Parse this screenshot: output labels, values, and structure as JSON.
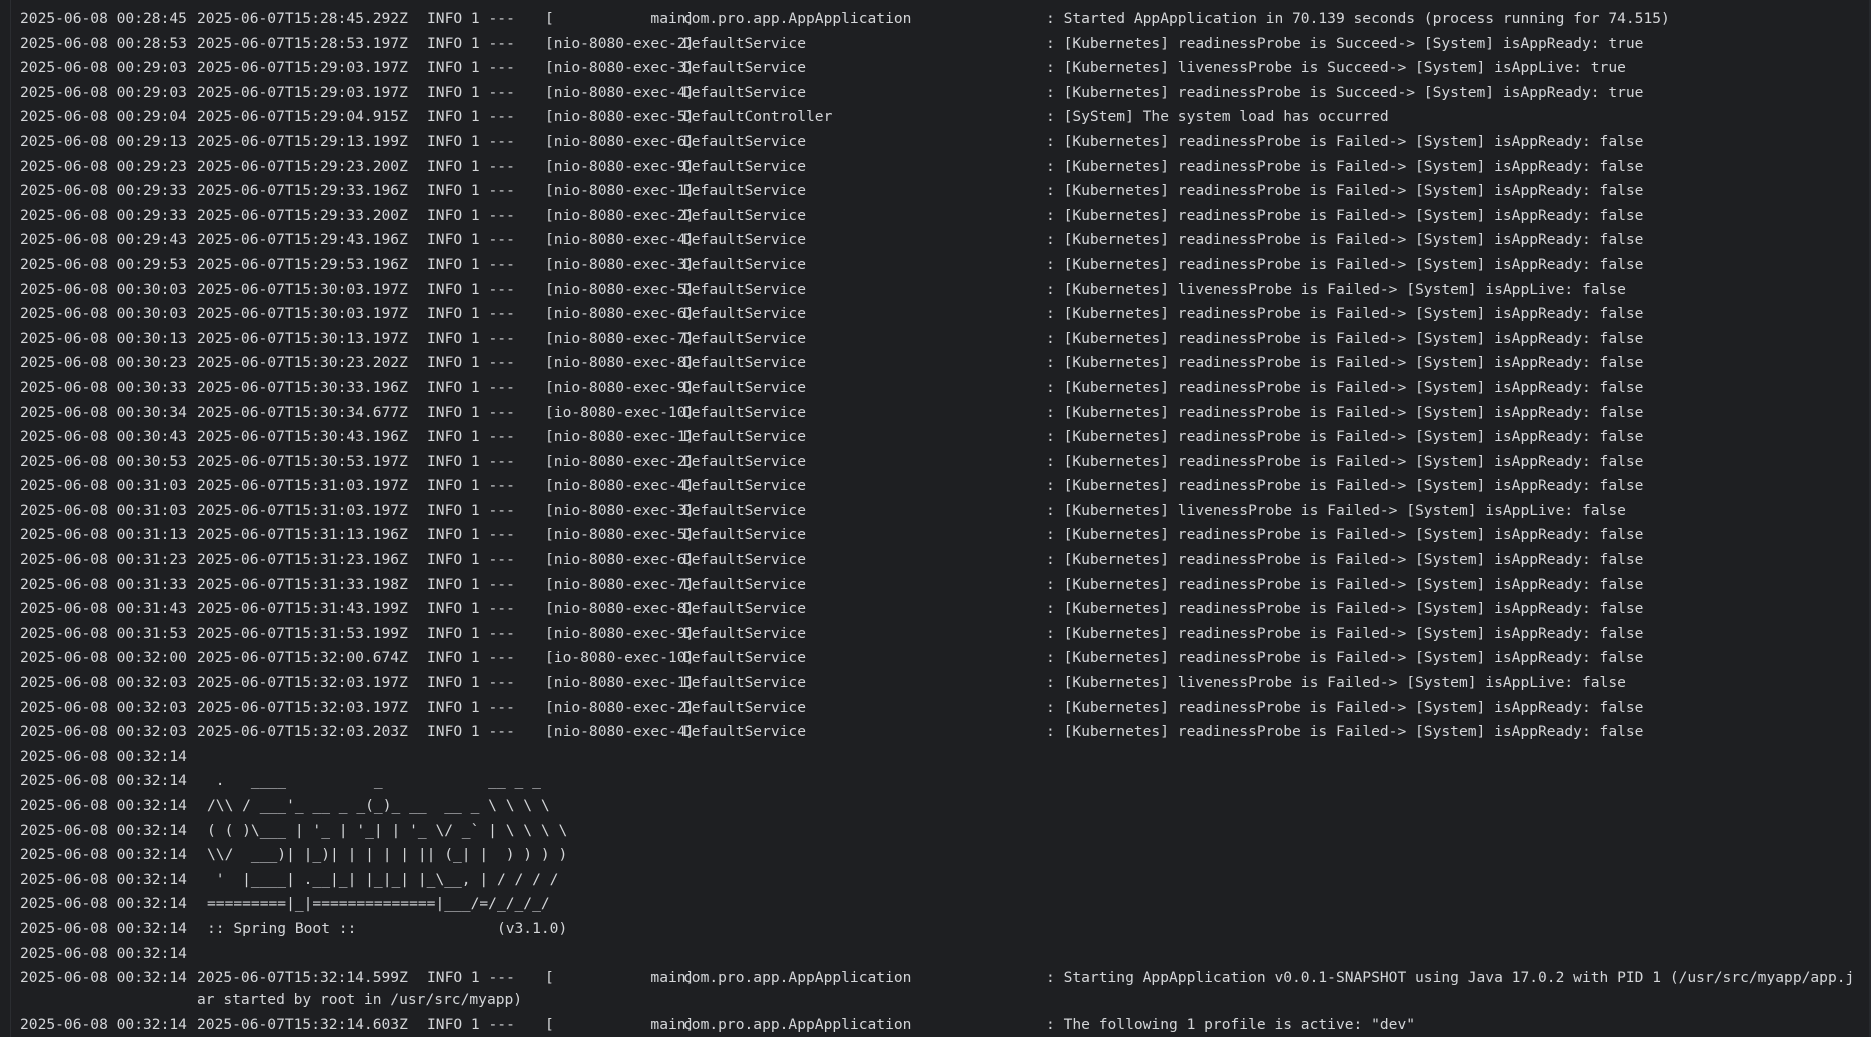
{
  "window": {
    "title": ""
  },
  "log_lines": [
    {
      "ts": "2025-06-08 00:28:45",
      "iso": "2025-06-07T15:28:45.292Z",
      "level": "INFO 1 ---",
      "thread": "[           main]",
      "logger": "com.pro.app.AppApplication",
      "msg": ": Started AppApplication in 70.139 seconds (process running for 74.515)"
    },
    {
      "ts": "2025-06-08 00:28:53",
      "iso": "2025-06-07T15:28:53.197Z",
      "level": "INFO 1 ---",
      "thread": "[nio-8080-exec-2]",
      "logger": "DefaultService",
      "msg": ": [Kubernetes] readinessProbe is Succeed-> [System] isAppReady: true"
    },
    {
      "ts": "2025-06-08 00:29:03",
      "iso": "2025-06-07T15:29:03.197Z",
      "level": "INFO 1 ---",
      "thread": "[nio-8080-exec-3]",
      "logger": "DefaultService",
      "msg": ": [Kubernetes] livenessProbe is Succeed-> [System] isAppLive: true"
    },
    {
      "ts": "2025-06-08 00:29:03",
      "iso": "2025-06-07T15:29:03.197Z",
      "level": "INFO 1 ---",
      "thread": "[nio-8080-exec-4]",
      "logger": "DefaultService",
      "msg": ": [Kubernetes] readinessProbe is Succeed-> [System] isAppReady: true"
    },
    {
      "ts": "2025-06-08 00:29:04",
      "iso": "2025-06-07T15:29:04.915Z",
      "level": "INFO 1 ---",
      "thread": "[nio-8080-exec-5]",
      "logger": "DefaultController",
      "msg": ": [SyStem] The system load has occurred"
    },
    {
      "ts": "2025-06-08 00:29:13",
      "iso": "2025-06-07T15:29:13.199Z",
      "level": "INFO 1 ---",
      "thread": "[nio-8080-exec-6]",
      "logger": "DefaultService",
      "msg": ": [Kubernetes] readinessProbe is Failed-> [System] isAppReady: false"
    },
    {
      "ts": "2025-06-08 00:29:23",
      "iso": "2025-06-07T15:29:23.200Z",
      "level": "INFO 1 ---",
      "thread": "[nio-8080-exec-9]",
      "logger": "DefaultService",
      "msg": ": [Kubernetes] readinessProbe is Failed-> [System] isAppReady: false"
    },
    {
      "ts": "2025-06-08 00:29:33",
      "iso": "2025-06-07T15:29:33.196Z",
      "level": "INFO 1 ---",
      "thread": "[nio-8080-exec-1]",
      "logger": "DefaultService",
      "msg": ": [Kubernetes] readinessProbe is Failed-> [System] isAppReady: false"
    },
    {
      "ts": "2025-06-08 00:29:33",
      "iso": "2025-06-07T15:29:33.200Z",
      "level": "INFO 1 ---",
      "thread": "[nio-8080-exec-2]",
      "logger": "DefaultService",
      "msg": ": [Kubernetes] readinessProbe is Failed-> [System] isAppReady: false"
    },
    {
      "ts": "2025-06-08 00:29:43",
      "iso": "2025-06-07T15:29:43.196Z",
      "level": "INFO 1 ---",
      "thread": "[nio-8080-exec-4]",
      "logger": "DefaultService",
      "msg": ": [Kubernetes] readinessProbe is Failed-> [System] isAppReady: false"
    },
    {
      "ts": "2025-06-08 00:29:53",
      "iso": "2025-06-07T15:29:53.196Z",
      "level": "INFO 1 ---",
      "thread": "[nio-8080-exec-3]",
      "logger": "DefaultService",
      "msg": ": [Kubernetes] readinessProbe is Failed-> [System] isAppReady: false"
    },
    {
      "ts": "2025-06-08 00:30:03",
      "iso": "2025-06-07T15:30:03.197Z",
      "level": "INFO 1 ---",
      "thread": "[nio-8080-exec-5]",
      "logger": "DefaultService",
      "msg": ": [Kubernetes] livenessProbe is Failed-> [System] isAppLive: false"
    },
    {
      "ts": "2025-06-08 00:30:03",
      "iso": "2025-06-07T15:30:03.197Z",
      "level": "INFO 1 ---",
      "thread": "[nio-8080-exec-6]",
      "logger": "DefaultService",
      "msg": ": [Kubernetes] readinessProbe is Failed-> [System] isAppReady: false"
    },
    {
      "ts": "2025-06-08 00:30:13",
      "iso": "2025-06-07T15:30:13.197Z",
      "level": "INFO 1 ---",
      "thread": "[nio-8080-exec-7]",
      "logger": "DefaultService",
      "msg": ": [Kubernetes] readinessProbe is Failed-> [System] isAppReady: false"
    },
    {
      "ts": "2025-06-08 00:30:23",
      "iso": "2025-06-07T15:30:23.202Z",
      "level": "INFO 1 ---",
      "thread": "[nio-8080-exec-8]",
      "logger": "DefaultService",
      "msg": ": [Kubernetes] readinessProbe is Failed-> [System] isAppReady: false"
    },
    {
      "ts": "2025-06-08 00:30:33",
      "iso": "2025-06-07T15:30:33.196Z",
      "level": "INFO 1 ---",
      "thread": "[nio-8080-exec-9]",
      "logger": "DefaultService",
      "msg": ": [Kubernetes] readinessProbe is Failed-> [System] isAppReady: false"
    },
    {
      "ts": "2025-06-08 00:30:34",
      "iso": "2025-06-07T15:30:34.677Z",
      "level": "INFO 1 ---",
      "thread": "[io-8080-exec-10]",
      "logger": "DefaultService",
      "msg": ": [Kubernetes] readinessProbe is Failed-> [System] isAppReady: false"
    },
    {
      "ts": "2025-06-08 00:30:43",
      "iso": "2025-06-07T15:30:43.196Z",
      "level": "INFO 1 ---",
      "thread": "[nio-8080-exec-1]",
      "logger": "DefaultService",
      "msg": ": [Kubernetes] readinessProbe is Failed-> [System] isAppReady: false"
    },
    {
      "ts": "2025-06-08 00:30:53",
      "iso": "2025-06-07T15:30:53.197Z",
      "level": "INFO 1 ---",
      "thread": "[nio-8080-exec-2]",
      "logger": "DefaultService",
      "msg": ": [Kubernetes] readinessProbe is Failed-> [System] isAppReady: false"
    },
    {
      "ts": "2025-06-08 00:31:03",
      "iso": "2025-06-07T15:31:03.197Z",
      "level": "INFO 1 ---",
      "thread": "[nio-8080-exec-4]",
      "logger": "DefaultService",
      "msg": ": [Kubernetes] readinessProbe is Failed-> [System] isAppReady: false"
    },
    {
      "ts": "2025-06-08 00:31:03",
      "iso": "2025-06-07T15:31:03.197Z",
      "level": "INFO 1 ---",
      "thread": "[nio-8080-exec-3]",
      "logger": "DefaultService",
      "msg": ": [Kubernetes] livenessProbe is Failed-> [System] isAppLive: false"
    },
    {
      "ts": "2025-06-08 00:31:13",
      "iso": "2025-06-07T15:31:13.196Z",
      "level": "INFO 1 ---",
      "thread": "[nio-8080-exec-5]",
      "logger": "DefaultService",
      "msg": ": [Kubernetes] readinessProbe is Failed-> [System] isAppReady: false"
    },
    {
      "ts": "2025-06-08 00:31:23",
      "iso": "2025-06-07T15:31:23.196Z",
      "level": "INFO 1 ---",
      "thread": "[nio-8080-exec-6]",
      "logger": "DefaultService",
      "msg": ": [Kubernetes] readinessProbe is Failed-> [System] isAppReady: false"
    },
    {
      "ts": "2025-06-08 00:31:33",
      "iso": "2025-06-07T15:31:33.198Z",
      "level": "INFO 1 ---",
      "thread": "[nio-8080-exec-7]",
      "logger": "DefaultService",
      "msg": ": [Kubernetes] readinessProbe is Failed-> [System] isAppReady: false"
    },
    {
      "ts": "2025-06-08 00:31:43",
      "iso": "2025-06-07T15:31:43.199Z",
      "level": "INFO 1 ---",
      "thread": "[nio-8080-exec-8]",
      "logger": "DefaultService",
      "msg": ": [Kubernetes] readinessProbe is Failed-> [System] isAppReady: false"
    },
    {
      "ts": "2025-06-08 00:31:53",
      "iso": "2025-06-07T15:31:53.199Z",
      "level": "INFO 1 ---",
      "thread": "[nio-8080-exec-9]",
      "logger": "DefaultService",
      "msg": ": [Kubernetes] readinessProbe is Failed-> [System] isAppReady: false"
    },
    {
      "ts": "2025-06-08 00:32:00",
      "iso": "2025-06-07T15:32:00.674Z",
      "level": "INFO 1 ---",
      "thread": "[io-8080-exec-10]",
      "logger": "DefaultService",
      "msg": ": [Kubernetes] readinessProbe is Failed-> [System] isAppReady: false"
    },
    {
      "ts": "2025-06-08 00:32:03",
      "iso": "2025-06-07T15:32:03.197Z",
      "level": "INFO 1 ---",
      "thread": "[nio-8080-exec-1]",
      "logger": "DefaultService",
      "msg": ": [Kubernetes] livenessProbe is Failed-> [System] isAppLive: false"
    },
    {
      "ts": "2025-06-08 00:32:03",
      "iso": "2025-06-07T15:32:03.197Z",
      "level": "INFO 1 ---",
      "thread": "[nio-8080-exec-2]",
      "logger": "DefaultService",
      "msg": ": [Kubernetes] readinessProbe is Failed-> [System] isAppReady: false"
    },
    {
      "ts": "2025-06-08 00:32:03",
      "iso": "2025-06-07T15:32:03.203Z",
      "level": "INFO 1 ---",
      "thread": "[nio-8080-exec-4]",
      "logger": "DefaultService",
      "msg": ": [Kubernetes] readinessProbe is Failed-> [System] isAppReady: false"
    }
  ],
  "banner_lines": [
    {
      "ts": "2025-06-08 00:32:14",
      "text": ""
    },
    {
      "ts": "2025-06-08 00:32:14",
      "text": " .   ____          _            __ _ _"
    },
    {
      "ts": "2025-06-08 00:32:14",
      "text": "/\\\\ / ___'_ __ _ _(_)_ __  __ _ \\ \\ \\ \\"
    },
    {
      "ts": "2025-06-08 00:32:14",
      "text": "( ( )\\___ | '_ | '_| | '_ \\/ _` | \\ \\ \\ \\"
    },
    {
      "ts": "2025-06-08 00:32:14",
      "text": "\\\\/  ___)| |_)| | | | | || (_| |  ) ) ) )"
    },
    {
      "ts": "2025-06-08 00:32:14",
      "text": " '  |____| .__|_| |_|_| |_\\__, | / / / /"
    },
    {
      "ts": "2025-06-08 00:32:14",
      "text": "=========|_|==============|___/=/_/_/_/"
    },
    {
      "ts": "2025-06-08 00:32:14",
      "text": ":: Spring Boot ::                (v3.1.0)"
    },
    {
      "ts": "2025-06-08 00:32:14",
      "text": ""
    }
  ],
  "tail_lines": [
    {
      "ts": "2025-06-08 00:32:14",
      "iso": "2025-06-07T15:32:14.599Z",
      "level": "INFO 1 ---",
      "thread": "[           main]",
      "logger": "com.pro.app.AppApplication",
      "msg": ": Starting AppApplication v0.0.1-SNAPSHOT using Java 17.0.2 with PID 1 (/usr/src/myapp/app.j",
      "cont": "ar started by root in /usr/src/myapp)"
    },
    {
      "ts": "2025-06-08 00:32:14",
      "iso": "2025-06-07T15:32:14.603Z",
      "level": "INFO 1 ---",
      "thread": "[           main]",
      "logger": "com.pro.app.AppApplication",
      "msg": ": The following 1 profile is active: \"dev\""
    }
  ],
  "colors": {
    "background": "#1e1f22",
    "text": "#d4d6d9"
  }
}
